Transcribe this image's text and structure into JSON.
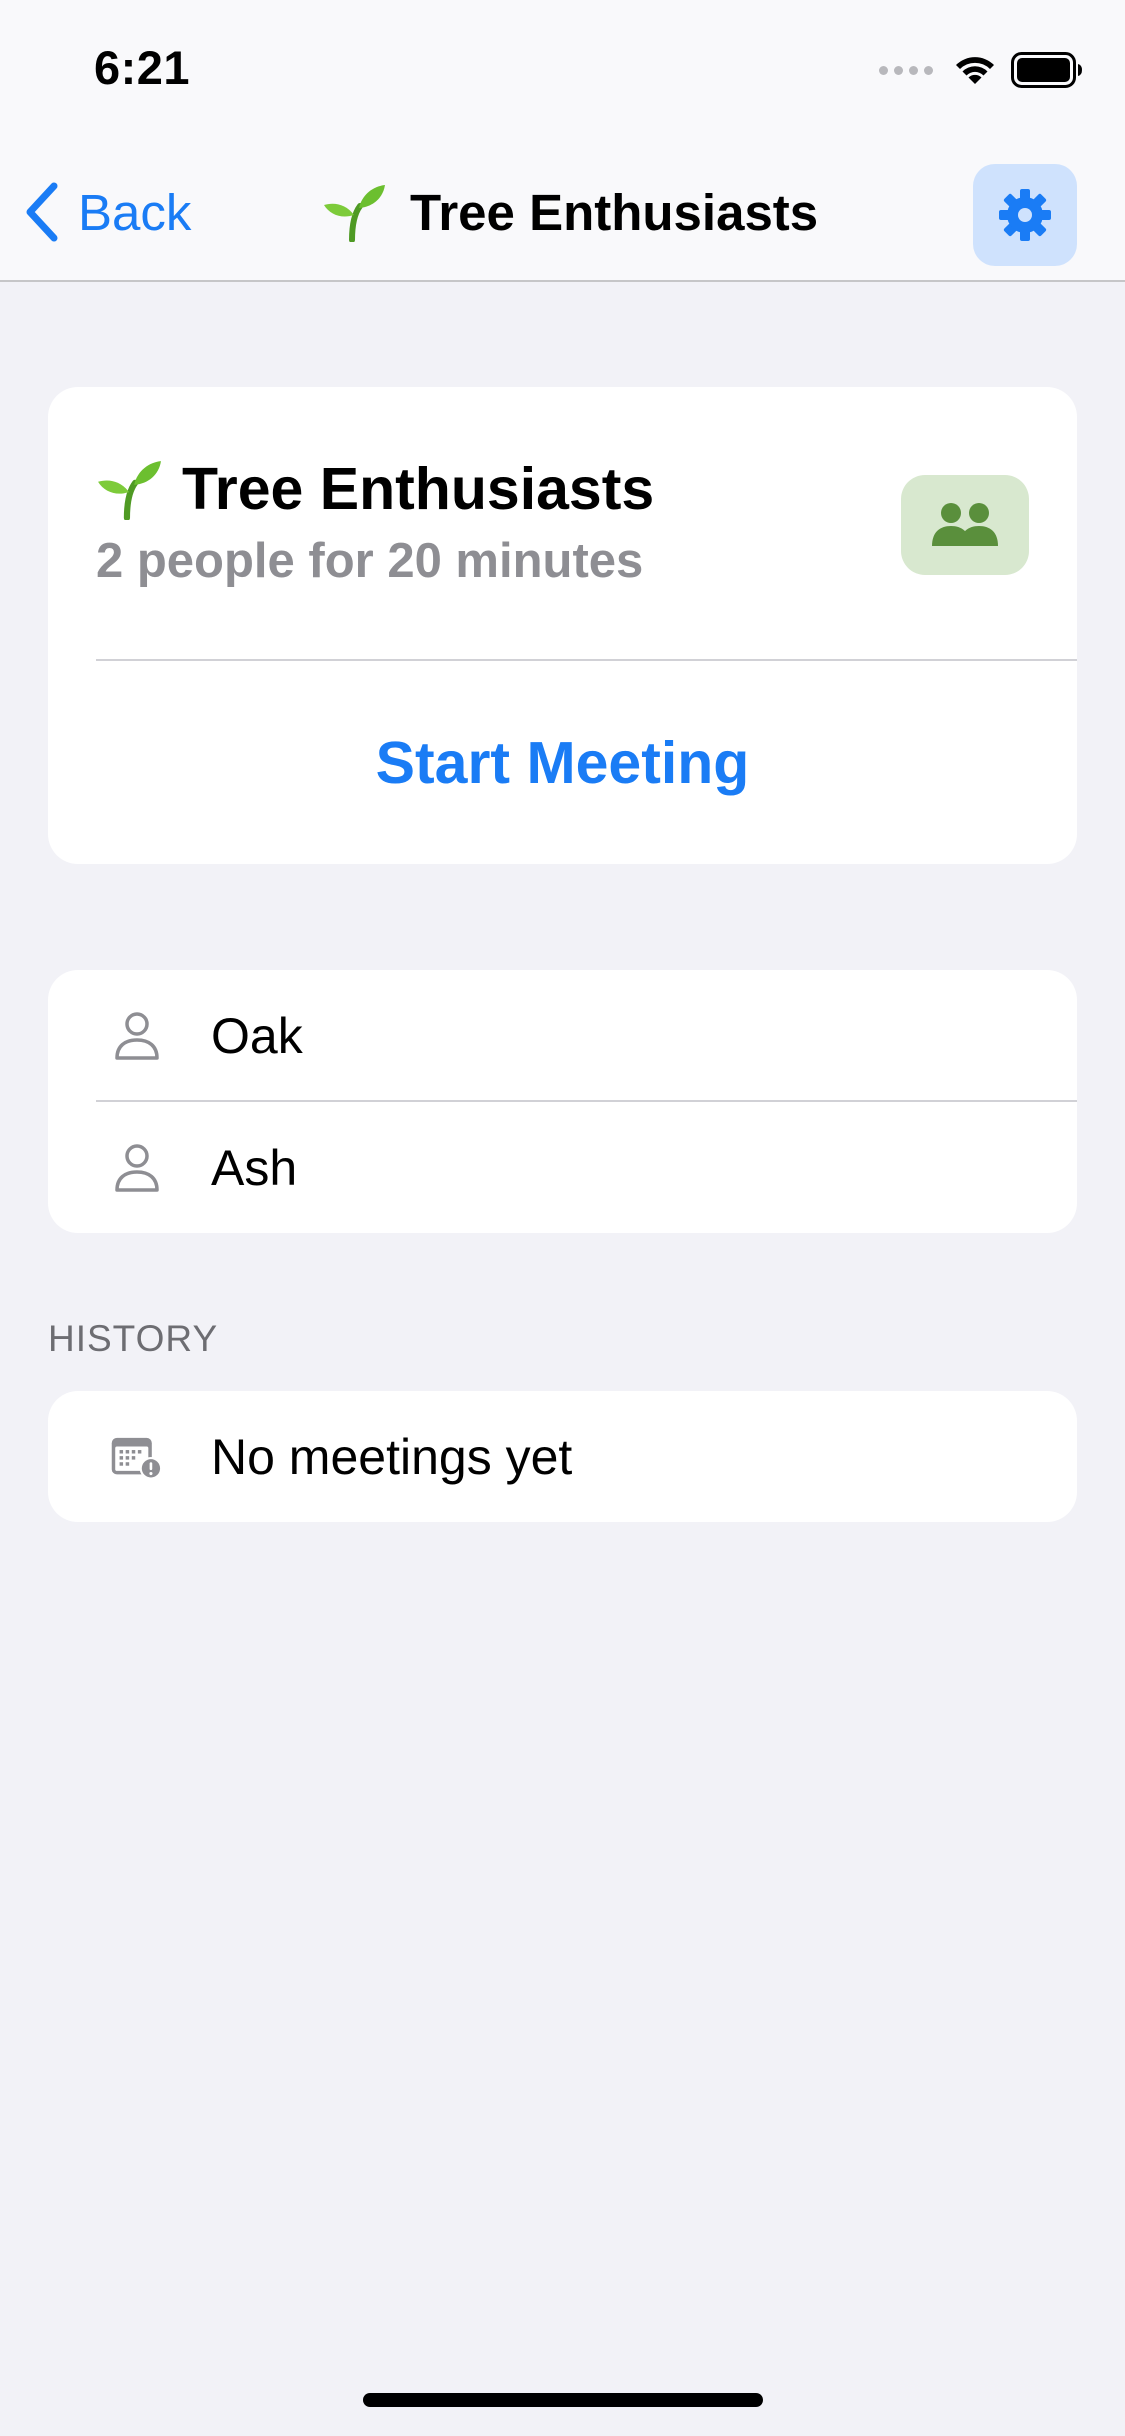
{
  "status_bar": {
    "time": "6:21"
  },
  "nav": {
    "back_label": "Back",
    "title": "Tree Enthusiasts",
    "settings_icon": "gear-icon"
  },
  "scrum": {
    "title": "Tree Enthusiasts",
    "subtitle": "2 people for 20 minutes",
    "theme_icon": "people-icon",
    "start_label": "Start Meeting"
  },
  "attendees": [
    {
      "name": "Oak",
      "icon": "person-icon"
    },
    {
      "name": "Ash",
      "icon": "person-icon"
    }
  ],
  "history": {
    "header": "HISTORY",
    "empty_label": "No meetings yet",
    "empty_icon": "calendar-badge-exclamationmark-icon"
  },
  "colors": {
    "accent": "#1a7cf5",
    "theme_badge_bg": "#d8e8cf",
    "theme_badge_fg": "#5a8f3c",
    "settings_bg": "#cfe2fd",
    "background": "#f2f2f7"
  }
}
